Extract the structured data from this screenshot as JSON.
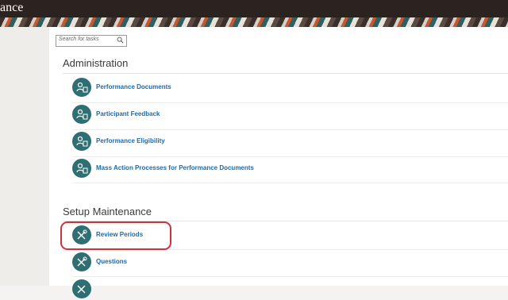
{
  "header": {
    "title": "ance"
  },
  "search": {
    "placeholder": "Search for tasks"
  },
  "sections": {
    "administration": {
      "title": "Administration",
      "items": [
        {
          "label": "Performance Documents"
        },
        {
          "label": "Participant Feedback"
        },
        {
          "label": "Performance Eligibility"
        },
        {
          "label": "Mass Action Processes for Performance Documents"
        }
      ]
    },
    "setup": {
      "title": "Setup Maintenance",
      "items": [
        {
          "label": "Review Periods"
        },
        {
          "label": "Questions"
        }
      ]
    }
  },
  "colors": {
    "accent": "#2e6f73",
    "link": "#1d6aa8",
    "highlight": "#d2303b",
    "topbar": "#2b2320"
  }
}
